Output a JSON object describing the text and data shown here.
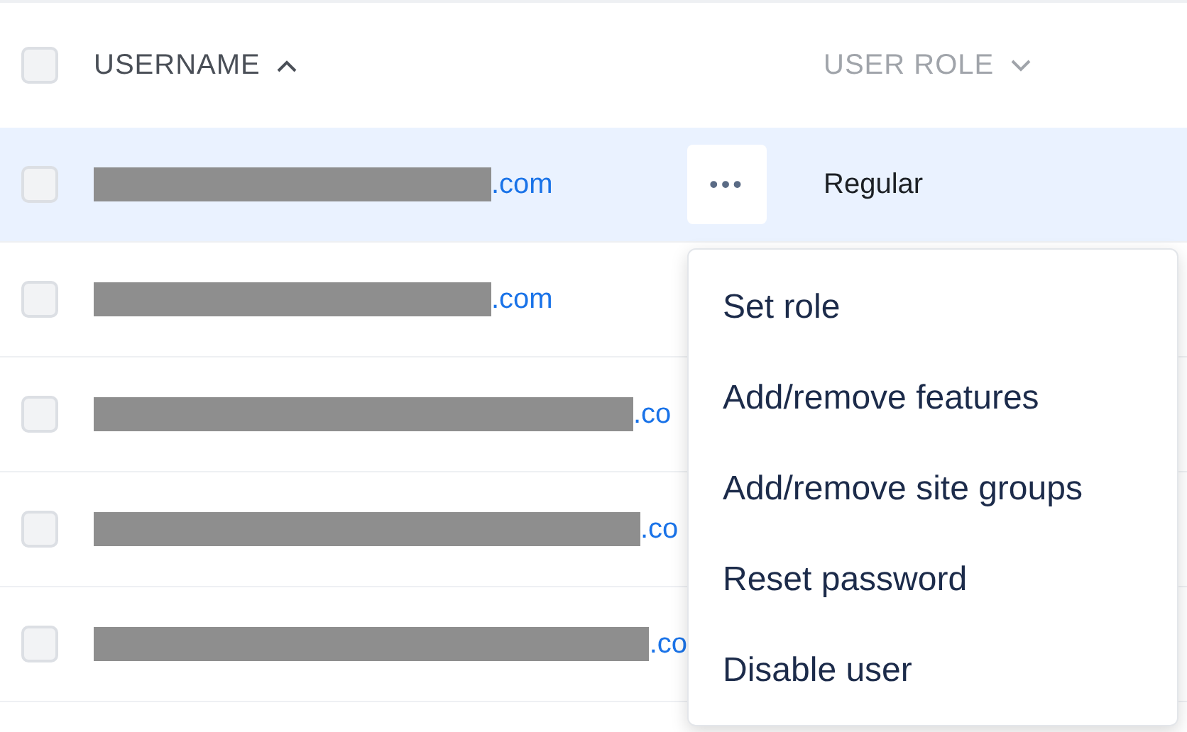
{
  "table": {
    "all_checked": false,
    "columns": [
      {
        "label": "USERNAME",
        "sorted": true
      },
      {
        "label": "USER ROLE",
        "sorted": false
      }
    ],
    "rows": [
      {
        "suffix": ".com",
        "selected": true,
        "checked": false,
        "role": "Regular",
        "actions": "•••"
      },
      {
        "suffix": ".com",
        "selected": false,
        "checked": false
      },
      {
        "suffix": ".co",
        "selected": false,
        "checked": false
      },
      {
        "suffix": ".co",
        "selected": false,
        "checked": false
      },
      {
        "suffix": ".co",
        "selected": false,
        "checked": false
      }
    ]
  },
  "menu": {
    "items": [
      "Set role",
      "Add/remove features",
      "Add/remove site groups",
      "Reset password",
      "Disable user"
    ]
  }
}
